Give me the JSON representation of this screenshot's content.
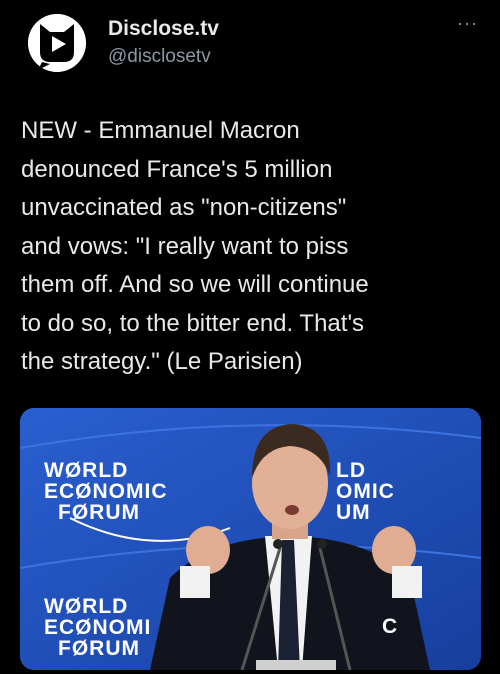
{
  "account": {
    "display_name": "Disclose.tv",
    "handle": "@disclosetv"
  },
  "more_icon": "···",
  "tweet": {
    "text": "NEW - Emmanuel Macron\ndenounced France's 5 million\nunvaccinated as \"non-citizens\"\nand vows: \"I really want to piss\nthem off. And so we will continue\nto do so, to the bitter end. That's\nthe strategy.\" (Le Parisien)"
  },
  "media": {
    "banner_left": [
      "WØRLD",
      "ECØNOMIC",
      "FØRUM"
    ],
    "banner_right": [
      "LD",
      "OMIC",
      "UM"
    ],
    "banner_bottom": [
      "WØRLD",
      "ECØNOMI",
      "FØRUM"
    ],
    "banner_bottom_right": "C"
  },
  "colors": {
    "background": "#000000",
    "text": "#e7e9ea",
    "secondary_text": "#8b98a5",
    "banner_blue": "#1f4fbf"
  },
  "icons": {
    "avatar": "disclose-tv-logo-icon",
    "more": "more-options-icon"
  }
}
